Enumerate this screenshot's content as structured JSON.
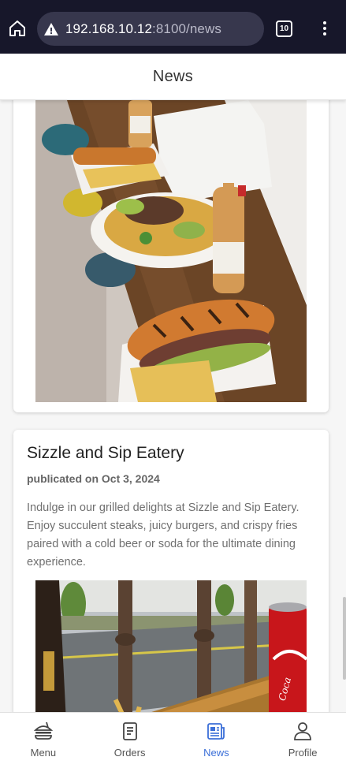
{
  "browser": {
    "url_host": "192.168.10.12",
    "url_path": ":8100/news",
    "tab_count": "10"
  },
  "header": {
    "title": "News"
  },
  "posts": [
    {
      "title": "",
      "date": "",
      "body": "",
      "image": "food-plates-sandwiches-nachos-beer"
    },
    {
      "title": "Sizzle and Sip Eatery",
      "date": "publicated on Oct 3, 2024",
      "body": "Indulge in our grilled delights at Sizzle and Sip Eatery. Enjoy succulent steaks, juicy burgers, and crispy fries paired with a cold beer or soda for the ultimate dining experience.",
      "image": "balcony-fries-cola-can"
    }
  ],
  "nav": [
    {
      "label": "Menu",
      "icon": "burger-icon",
      "active": false
    },
    {
      "label": "Orders",
      "icon": "clipboard-icon",
      "active": false
    },
    {
      "label": "News",
      "icon": "newspaper-icon",
      "active": true
    },
    {
      "label": "Profile",
      "icon": "person-icon",
      "active": false
    }
  ],
  "colors": {
    "accent": "#3b6fd8",
    "browser_bg": "#17172a",
    "url_pill": "#37374d"
  }
}
